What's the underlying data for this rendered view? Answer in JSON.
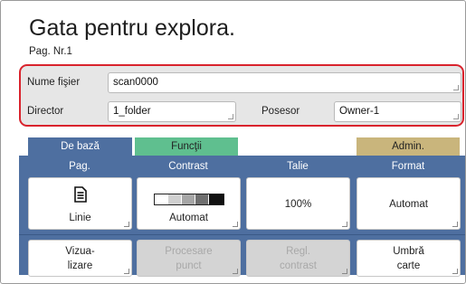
{
  "header": {
    "title": "Gata pentru explora.",
    "page_nr": "Pag. Nr.1"
  },
  "file": {
    "name_label": "Nume fişier",
    "name_value": "scan0000",
    "dir_label": "Director",
    "dir_value": "1_folder",
    "owner_label": "Posesor",
    "owner_value": "Owner-1"
  },
  "tabs": {
    "basic": "De bază",
    "functions": "Funcţii",
    "admin": "Admin."
  },
  "columns": {
    "page": "Pag.",
    "contrast": "Contrast",
    "size": "Talie",
    "format": "Format"
  },
  "buttons": {
    "page": "Linie",
    "contrast": "Automat",
    "size": "100%",
    "format": "Automat",
    "preview_l1": "Vizua-",
    "preview_l2": "lizare",
    "dot_l1": "Procesare",
    "dot_l2": "punct",
    "regl_l1": "Regl.",
    "regl_l2": "contrast",
    "shadow_l1": "Umbră",
    "shadow_l2": "carte"
  },
  "colors": {
    "accent_red": "#d9232d",
    "tab_blue": "#4e6fa0",
    "tab_green": "#5fbf8f",
    "tab_admin": "#c9b57c"
  }
}
